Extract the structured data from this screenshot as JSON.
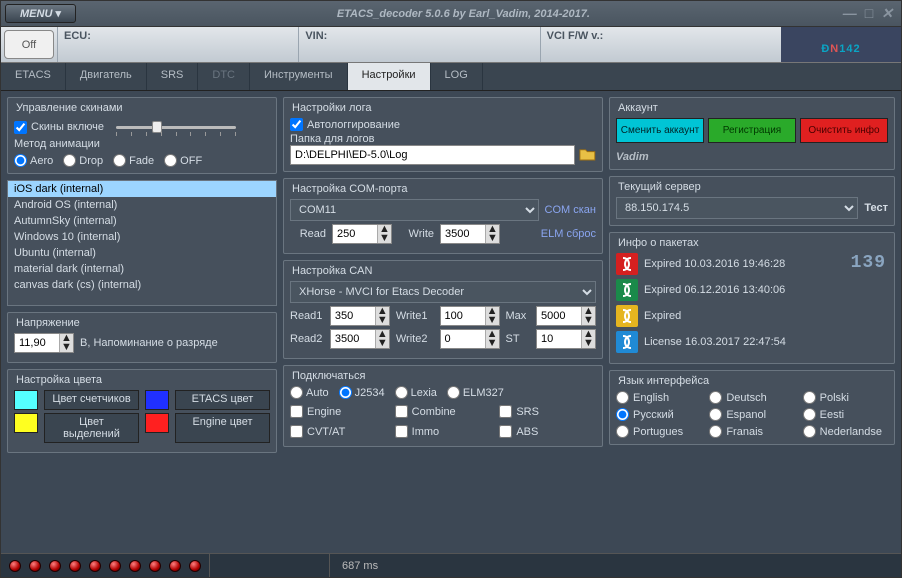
{
  "window": {
    "menu_label": "MENU",
    "title": "ETACS_decoder 5.0.6 by Earl_Vadim, 2014-2017."
  },
  "infobar": {
    "off": "Off",
    "ecu": "ECU:",
    "vin": "VIN:",
    "fw": "VCI F/W v.:",
    "digits": "142"
  },
  "tabs": [
    "ETACS",
    "Двигатель",
    "SRS",
    "DTC",
    "Инструменты",
    "Настройки",
    "LOG"
  ],
  "active_tab": 5,
  "skins": {
    "group_title": "Управление скинами",
    "enabled_label": "Скины включе",
    "anim_label": "Метод анимации",
    "anim_options": [
      "Aero",
      "Drop",
      "Fade",
      "OFF"
    ],
    "list": [
      "iOS dark (internal)",
      "Android OS (internal)",
      "AutumnSky (internal)",
      "Windows 10 (internal)",
      "Ubuntu (internal)",
      "material dark (internal)",
      "canvas dark (cs) (internal)"
    ]
  },
  "voltage": {
    "group_title": "Напряжение",
    "value": "11,90",
    "hint": "В, Напоминание о разряде"
  },
  "colors": {
    "group_title": "Настройка цвета",
    "btn_counter": "Цвет счетчиков",
    "btn_etacs": "ETACS цвет",
    "btn_select": "Цвет выделений",
    "btn_engine": "Engine цвет",
    "sw_counter": "#55ffff",
    "sw_etacs": "#2030ff",
    "sw_select": "#ffff20",
    "sw_engine": "#ff2020"
  },
  "log": {
    "group_title": "Настройки лога",
    "auto_label": "Автологгирование",
    "folder_label": "Папка для логов",
    "folder_path": "D:\\DELPHI\\ED-5.0\\Log"
  },
  "com": {
    "group_title": "Настройка COM-порта",
    "port": "COM11",
    "scan": "COM скан",
    "read_label": "Read",
    "read": "250",
    "write_label": "Write",
    "write": "3500",
    "reset": "ELM сброс"
  },
  "can": {
    "group_title": "Настройка CAN",
    "iface": "XHorse - MVCI for Etacs Decoder",
    "read1_l": "Read1",
    "read1": "350",
    "write1_l": "Write1",
    "write1": "100",
    "max_l": "Max",
    "max": "5000",
    "read2_l": "Read2",
    "read2": "3500",
    "write2_l": "Write2",
    "write2": "0",
    "st_l": "ST",
    "st": "10"
  },
  "connect": {
    "group_title": "Подключаться",
    "modes": [
      "Auto",
      "J2534",
      "Lexia",
      "ELM327"
    ],
    "checks": [
      "Engine",
      "Combine",
      "SRS",
      "CVT/AT",
      "Immo",
      "ABS"
    ]
  },
  "account": {
    "group_title": "Аккаунт",
    "btn_change": "Сменить аккаунт",
    "btn_reg": "Регистрация",
    "btn_clear": "Очистить инфо",
    "name": "Vadim"
  },
  "server": {
    "group_title": "Текущий сервер",
    "addr": "88.150.174.5",
    "test": "Тест"
  },
  "packets": {
    "group_title": "Инфо о пакетах",
    "counter": "139",
    "rows": [
      {
        "color": "red",
        "text": "Expired 10.03.2016 19:46:28"
      },
      {
        "color": "green",
        "text": "Expired 06.12.2016 13:40:06"
      },
      {
        "color": "yellow",
        "text": "Expired"
      },
      {
        "color": "blue",
        "text": "License 16.03.2017 22:47:54"
      }
    ]
  },
  "lang": {
    "group_title": "Язык интерфейса",
    "options": [
      "English",
      "Deutsch",
      "Polski",
      "Русский",
      "Espanol",
      "Eesti",
      "Portugues",
      "Franais",
      "Nederlandse"
    ],
    "selected": 3
  },
  "status": {
    "ms": "687 ms"
  }
}
